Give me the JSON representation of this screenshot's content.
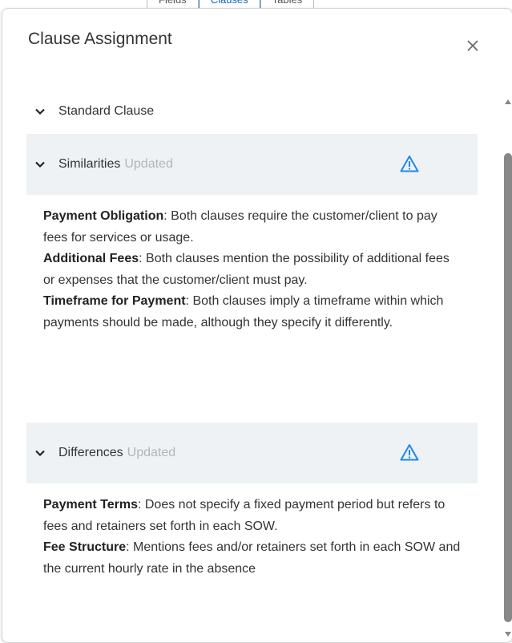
{
  "background_tabs": [
    "Fields",
    "Clauses",
    "Tables"
  ],
  "panel": {
    "title": "Clause Assignment",
    "close_label": "×"
  },
  "sections": {
    "standard": {
      "label": "Standard Clause"
    },
    "similarities": {
      "label": "Similarities",
      "status": "Updated",
      "items": [
        {
          "term": "Payment Obligation",
          "text": ": Both clauses require the customer/client to pay fees for services or usage."
        },
        {
          "term": "Additional Fees",
          "text": ": Both clauses mention the possibility of additional fees or expenses that the customer/client must pay."
        },
        {
          "term": "Timeframe for Payment",
          "text": ": Both clauses imply a timeframe within which payments should be made, although they specify it differently."
        }
      ]
    },
    "differences": {
      "label": "Differences",
      "status": "Updated",
      "items": [
        {
          "term": "Payment Terms",
          "text": ": Does not specify a fixed payment period but refers to fees and retainers set forth in each SOW."
        },
        {
          "term": "Fee Structure",
          "text": ": Mentions fees and/or retainers set forth in each SOW and the current hourly rate in the absence"
        }
      ]
    }
  },
  "colors": {
    "section_bg": "#eef2f5",
    "warning_blue": "#1e88e5",
    "updated_gray": "#b5b5b5"
  },
  "icons": {
    "chevron": "chevron-down-icon",
    "warning": "warning-triangle-icon",
    "close": "close-icon"
  }
}
